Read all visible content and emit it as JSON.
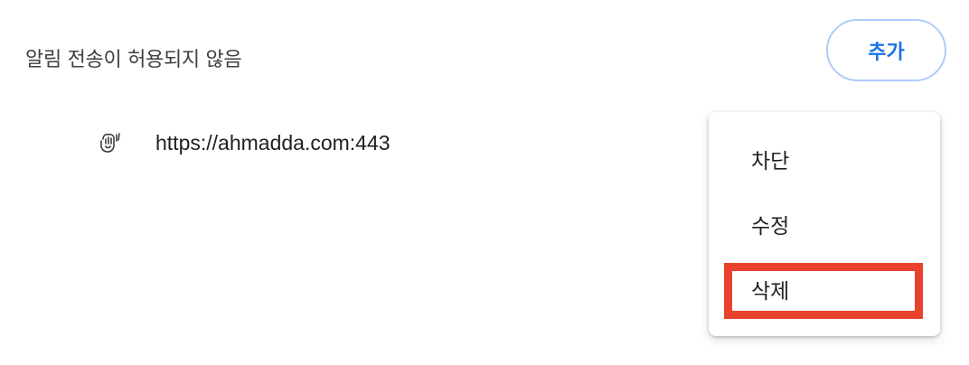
{
  "section": {
    "title": "알림 전송이 허용되지 않음",
    "add_label": "추가"
  },
  "site": {
    "icon": "waving-hand-icon",
    "url": "https://ahmadda.com:443"
  },
  "menu": {
    "items": [
      {
        "label": "차단"
      },
      {
        "label": "수정"
      },
      {
        "label": "삭제"
      }
    ]
  },
  "colors": {
    "accent": "#1a73e8",
    "button_border": "#aecbfa",
    "highlight": "#e8412c"
  }
}
